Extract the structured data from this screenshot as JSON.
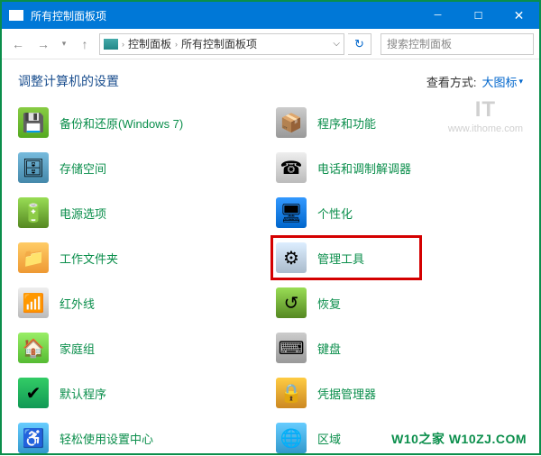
{
  "titlebar": {
    "title": "所有控制面板项"
  },
  "breadcrumb": {
    "level1": "控制面板",
    "level2": "所有控制面板项"
  },
  "search": {
    "placeholder": "搜索控制面板"
  },
  "viewbar": {
    "heading": "调整计算机的设置",
    "viewlabel": "查看方式:",
    "viewvalue": "大图标"
  },
  "items": {
    "backup": "备份和还原(Windows 7)",
    "programs": "程序和功能",
    "storage": "存储空间",
    "phone": "电话和调制解调器",
    "power": "电源选项",
    "personalization": "个性化",
    "workfolders": "工作文件夹",
    "admin": "管理工具",
    "infrared": "红外线",
    "recovery": "恢复",
    "homegroup": "家庭组",
    "keyboard": "键盘",
    "default": "默认程序",
    "credentials": "凭据管理器",
    "ease": "轻松使用设置中心",
    "region": "区域"
  },
  "watermark": {
    "main": "IT",
    "sub": "www.ithome.com"
  },
  "footer": {
    "brand": "W10之家 W10ZJ.COM"
  }
}
